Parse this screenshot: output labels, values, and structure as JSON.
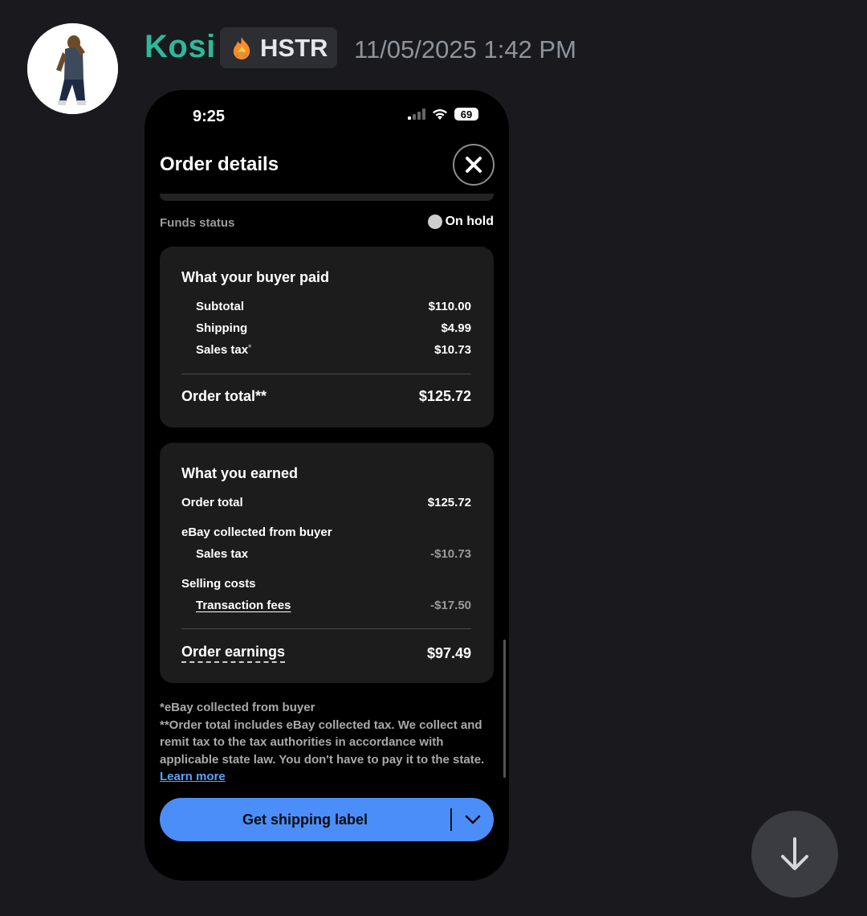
{
  "message": {
    "username": "Kosi",
    "role_tag": "HSTR",
    "timestamp": "11/05/2025 1:42 PM"
  },
  "phone": {
    "status_time": "9:25",
    "battery": "69",
    "title": "Order details",
    "funds_status_label": "Funds status",
    "funds_status_value": "On hold",
    "buyer_paid": {
      "title": "What your buyer paid",
      "subtotal_label": "Subtotal",
      "subtotal_value": "$110.00",
      "shipping_label": "Shipping",
      "shipping_value": "$4.99",
      "tax_label": "Sales tax",
      "tax_marker": "*",
      "tax_value": "$10.73",
      "total_label": "Order total**",
      "total_value": "$125.72"
    },
    "earned": {
      "title": "What you earned",
      "order_total_label": "Order total",
      "order_total_value": "$125.72",
      "collected_label": "eBay collected from buyer",
      "sales_tax_label": "Sales tax",
      "sales_tax_value": "-$10.73",
      "selling_costs_label": "Selling costs",
      "fees_label": "Transaction fees",
      "fees_value": "-$17.50",
      "earnings_label": "Order earnings",
      "earnings_value": "$97.49"
    },
    "footnote_1": "*eBay collected from buyer",
    "footnote_2": "**Order total includes eBay collected tax. We collect and remit tax to the tax authorities in accordance with applicable state law. You don't have to pay it to the state.",
    "learn_more": "Learn more",
    "shipping_button": "Get shipping label"
  },
  "icons": {
    "tag_icon": "fire-icon",
    "close": "close-icon",
    "dropdown": "chevron-down-icon",
    "scroll": "arrow-down-icon"
  },
  "colors": {
    "username": "#2fb89a",
    "primary_button": "#4b8efa",
    "link": "#5aa2ff",
    "background": "#1a1a1e"
  }
}
